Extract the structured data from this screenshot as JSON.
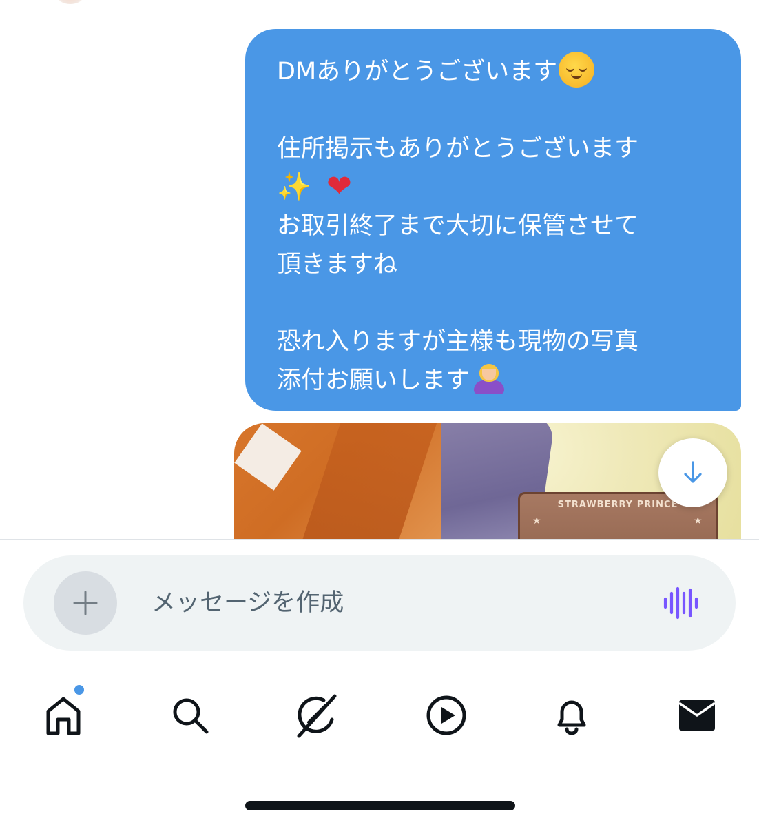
{
  "conversation": {
    "message": {
      "line1": "DMありがとうございます",
      "line1_emoji": "relieved-face",
      "line2": "住所掲示もありがとうございます",
      "line3_emojis": [
        "sparkles",
        "red-heart"
      ],
      "line4": "お取引終了まで大切に保管させて",
      "line5": "頂きますね",
      "line6": "恐れ入りますが主様も現物の写真",
      "line7": "添付お願いします",
      "line7_emoji": "person-bowing",
      "bubble_color": "#4A97E6"
    },
    "photo_attachment": {
      "card_text": "STRAWBERRY PRINCE"
    }
  },
  "composer": {
    "placeholder": "メッセージを作成",
    "plus_icon": "plus-icon",
    "voice_icon": "voice-waveform-icon",
    "voice_color": "#7856FF"
  },
  "bottom_nav": {
    "items": [
      "home-icon",
      "search-icon",
      "grok-icon",
      "video-icon",
      "notifications-icon",
      "messages-icon"
    ],
    "home_badge_color": "#4A97E6"
  }
}
